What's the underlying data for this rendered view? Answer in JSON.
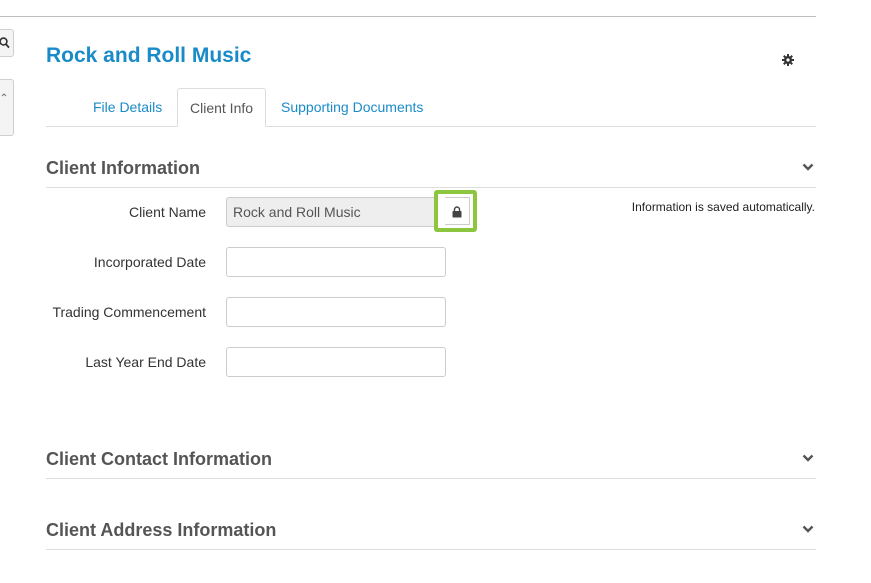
{
  "page": {
    "title": "Rock and Roll Music",
    "settings_icon": "gear-icon"
  },
  "side_toolbar": {
    "search_icon": "search-icon",
    "collapse_icon": "chevron-icon"
  },
  "tabs": [
    {
      "label": "File Details",
      "active": false
    },
    {
      "label": "Client Info",
      "active": true
    },
    {
      "label": "Supporting Documents",
      "active": false
    }
  ],
  "sections": {
    "client_information": {
      "title": "Client Information",
      "saved_note": "Information is saved automatically.",
      "fields": [
        {
          "label": "Client Name",
          "value": "Rock and Roll Music",
          "readonly": true
        },
        {
          "label": "Incorporated Date",
          "value": ""
        },
        {
          "label": "Trading Commencement",
          "value": ""
        },
        {
          "label": "Last Year End Date",
          "value": ""
        }
      ],
      "lock_icon": "lock-icon",
      "highlight_color": "#8cc63f"
    },
    "client_contact_information": {
      "title": "Client Contact Information"
    },
    "client_address_information": {
      "title": "Client Address Information"
    }
  },
  "colors": {
    "accent": "#1a8bc9",
    "highlight": "#8cc63f"
  }
}
